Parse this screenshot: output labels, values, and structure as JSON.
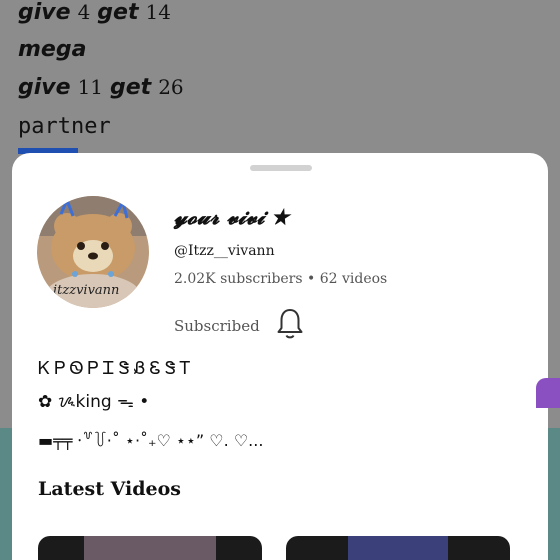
{
  "background": {
    "line1": {
      "word1": "give",
      "num1": "4",
      "word2": "get",
      "num2": "14"
    },
    "line2": {
      "word": "mega"
    },
    "line3": {
      "word1": "give",
      "num1": "11",
      "word2": "get",
      "num2": "26"
    },
    "line4": {
      "text": "partner"
    }
  },
  "sheet": {
    "channel_name": "𝔂𝓸𝓾𝓻 𝓿𝓲𝓿𝓲 ★",
    "handle": "@Itzz__vivann",
    "stats": "2.02K subscribers • 62 videos",
    "subscribed_label": "Subscribed",
    "bio": {
      "line1": "ᏦᏢᏫᏢᏆᏕᏰᏋᏕᎢ",
      "line2": "✿ ᝰking ᯓ •",
      "line3": "▬╤╤ ⸱꒷꒦·˚ ⋆·˚₊♡ ⋆⋆” ♡. ♡..."
    },
    "latest_videos_title": "Latest Videos",
    "avatar_text": "itzzvivann"
  },
  "colors": {
    "accent_blue": "#1f4fb0",
    "sheet_bg": "#ffffff",
    "teal": "#5b8a86"
  }
}
